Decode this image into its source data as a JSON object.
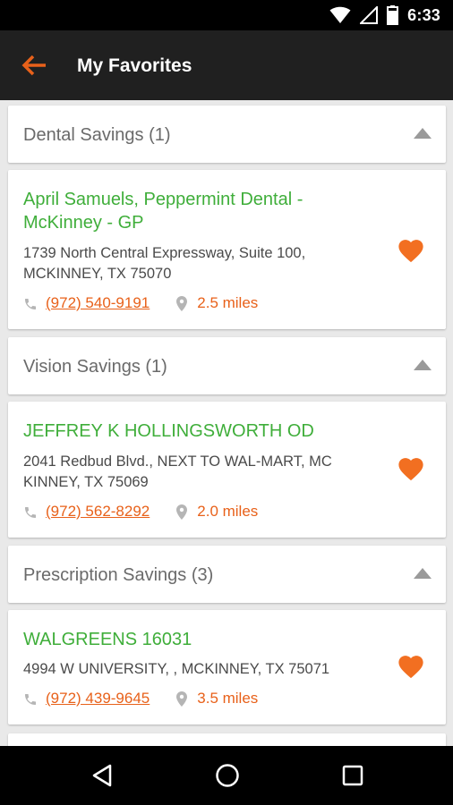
{
  "status_bar": {
    "time": "6:33",
    "icons": [
      "wifi-icon",
      "cell-signal-icon",
      "battery-icon"
    ]
  },
  "app_bar": {
    "title": "My Favorites",
    "back_icon": "arrow-left-icon"
  },
  "colors": {
    "accent": "#e8611a",
    "provider_name": "#3fae3a",
    "app_bar": "#202020",
    "background": "#e9e9e9"
  },
  "sections": [
    {
      "title": "Dental Savings (1)",
      "providers": [
        {
          "name": "April Samuels, Peppermint Dental - McKinney - GP",
          "address_line1": "1739 North Central Expressway, Suite 100,",
          "address_line2": "MCKINNEY, TX 75070",
          "phone": "(972) 540-9191",
          "distance": "2.5 miles",
          "favorited": true
        }
      ]
    },
    {
      "title": "Vision Savings (1)",
      "providers": [
        {
          "name": "JEFFREY K HOLLINGSWORTH  OD",
          "address_line1": "2041 Redbud Blvd., NEXT TO WAL-MART, MC",
          "address_line2": "KINNEY, TX 75069",
          "phone": "(972) 562-8292",
          "distance": "2.0 miles",
          "favorited": true
        }
      ]
    },
    {
      "title": "Prescription Savings (3)",
      "providers": [
        {
          "name": "WALGREENS 16031",
          "address_line1": "4994 W UNIVERSITY, , MCKINNEY, TX 75071",
          "phone": "(972) 439-9645",
          "distance": "3.5 miles",
          "favorited": true
        }
      ]
    }
  ],
  "nav_bar": {
    "buttons": [
      "back-triangle-icon",
      "home-circle-icon",
      "recents-square-icon"
    ]
  }
}
